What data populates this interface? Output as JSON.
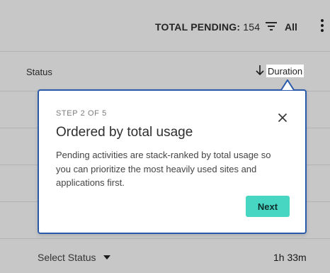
{
  "header": {
    "total_pending_label": "TOTAL PENDING:",
    "total_pending_value": "154",
    "filter_label": "All"
  },
  "table": {
    "columns": {
      "status": "Status",
      "duration": "Duration"
    },
    "visible_row": {
      "status_select": "Select Status",
      "duration": "1h 33m"
    }
  },
  "popup": {
    "step": "STEP 2 OF 5",
    "title": "Ordered by total usage",
    "body": "Pending activities are stack-ranked by total usage so you can prioritize the most heavily used sites and applications first.",
    "next_label": "Next"
  },
  "icons": {
    "filter": "filter-icon",
    "more": "more-vertical-icon",
    "sort": "arrow-down-icon",
    "close": "close-icon",
    "caret": "caret-down-icon"
  },
  "colors": {
    "popup_border": "#2a59a9",
    "next_button": "#46d6c1",
    "overlay": "rgba(0,0,0,0.22)"
  }
}
